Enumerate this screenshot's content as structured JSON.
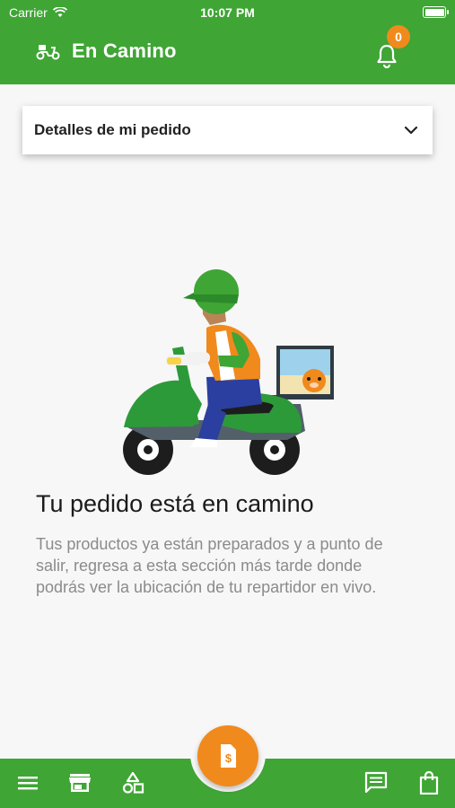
{
  "status_bar": {
    "carrier": "Carrier",
    "time": "10:07 PM"
  },
  "header": {
    "title": "En Camino",
    "notification_count": "0",
    "icon": "scooter-icon"
  },
  "order_details": {
    "label": "Detalles de mi pedido"
  },
  "message": {
    "title": "Tu pedido está en camino",
    "body": "Tus productos ya están preparados y a punto de salir, regresa a esta sección más tarde donde podrás ver la ubicación de tu repartidor en vivo."
  },
  "bottom_nav": {
    "items": [
      "menu-icon",
      "store-icon",
      "categories-icon",
      "chat-icon",
      "shopping-bag-icon"
    ],
    "fab_icon": "invoice-icon"
  },
  "colors": {
    "primary": "#3fa535",
    "accent": "#f08a1c"
  }
}
